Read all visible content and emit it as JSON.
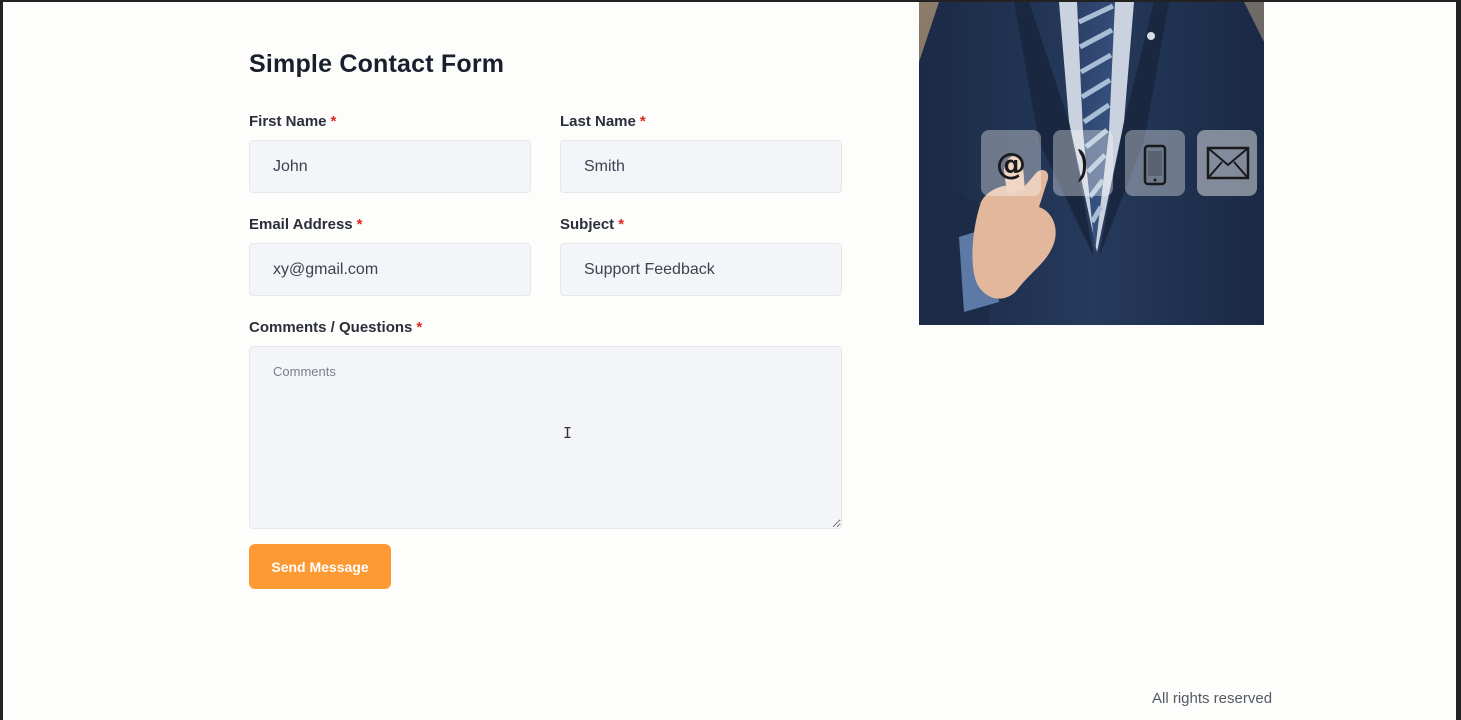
{
  "form": {
    "title": "Simple Contact Form",
    "required_mark": "*",
    "fields": {
      "first_name": {
        "label": "First Name",
        "value": "John"
      },
      "last_name": {
        "label": "Last Name",
        "value": "Smith"
      },
      "email": {
        "label": "Email Address",
        "value": "xy@gmail.com"
      },
      "subject": {
        "label": "Subject",
        "value": "Support Feedback"
      },
      "comments": {
        "label": "Comments / Questions",
        "placeholder": "Comments",
        "value": ""
      }
    },
    "submit_label": "Send Message"
  },
  "image": {
    "icons": [
      "at-sign-icon",
      "phone-handset-icon",
      "mobile-phone-icon",
      "envelope-icon"
    ],
    "icon_glyphs": {
      "at": "@"
    }
  },
  "footer": {
    "text": "All rights reserved"
  },
  "colors": {
    "accent": "#fd9a33",
    "required": "#e0281e",
    "input_bg": "#f4f5f9",
    "suit": "#1f2e4a"
  }
}
